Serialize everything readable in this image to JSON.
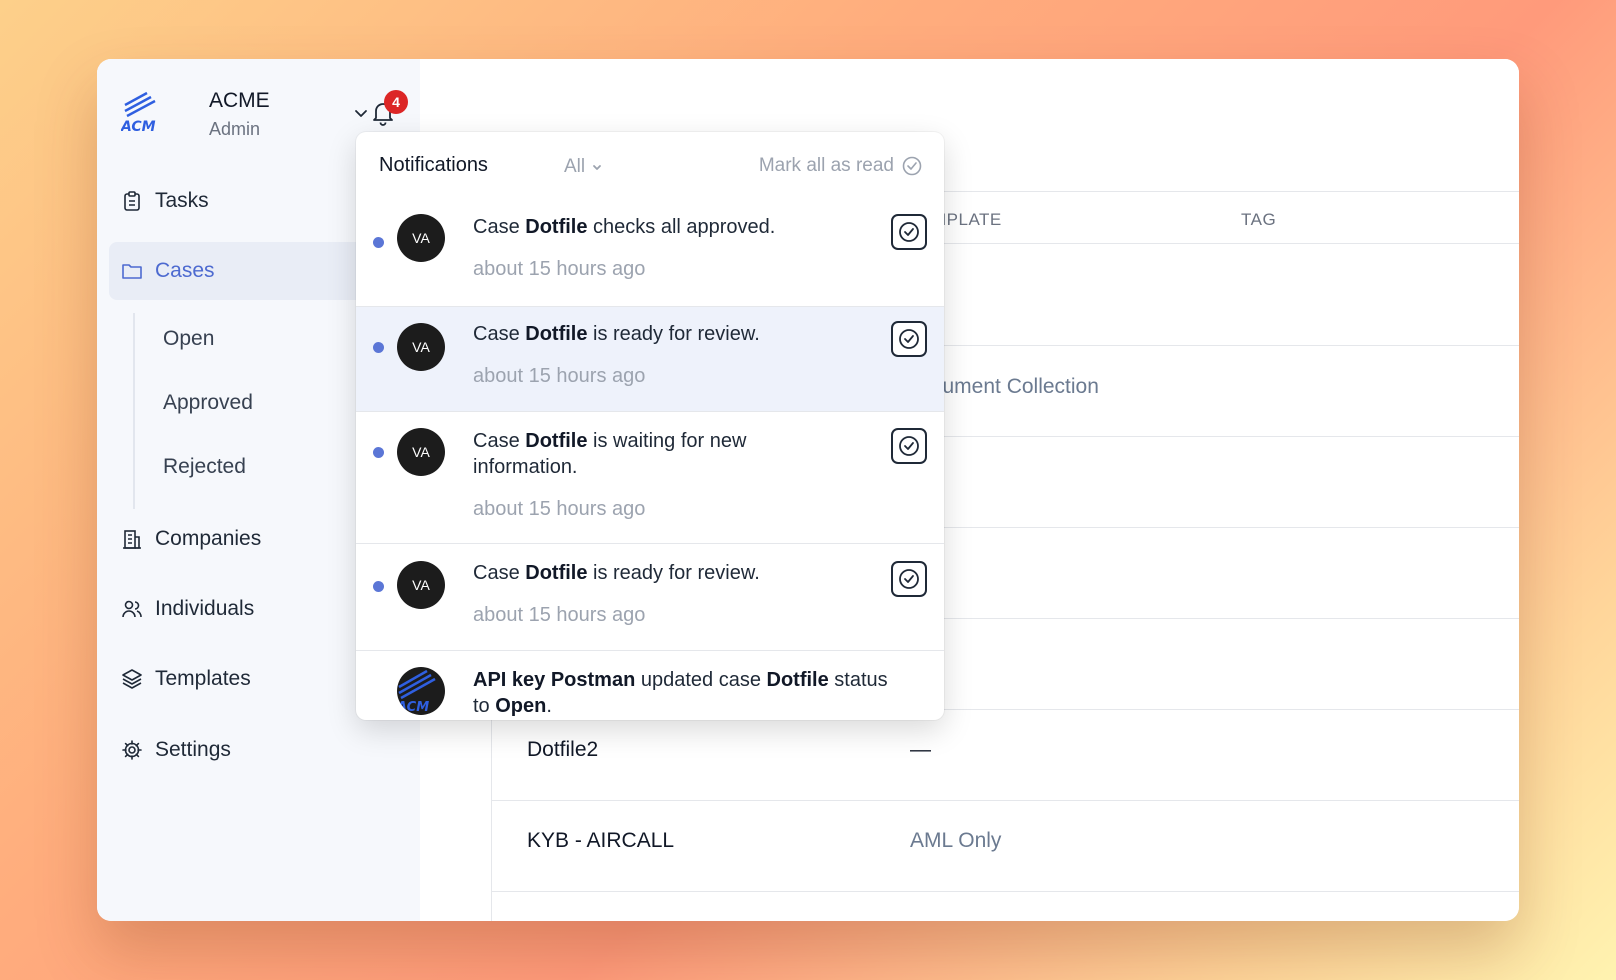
{
  "brand": {
    "name": "ACME",
    "role": "Admin",
    "logo_text": "ACM",
    "notification_count": "4"
  },
  "nav": {
    "tasks": "Tasks",
    "cases": "Cases",
    "sub": {
      "open": "Open",
      "approved": "Approved",
      "rejected": "Rejected"
    },
    "companies": "Companies",
    "individuals": "Individuals",
    "templates": "Templates",
    "settings": "Settings"
  },
  "table": {
    "headers": {
      "template": "MPLATE",
      "tag": "TAG"
    },
    "rows": [
      {
        "name": "",
        "template": ""
      },
      {
        "name": "",
        "template": "cument Collection"
      },
      {
        "name": "",
        "template": ""
      },
      {
        "name": "",
        "template": ""
      },
      {
        "name": "",
        "template": ""
      },
      {
        "name": "Dotfile2",
        "template": "—"
      },
      {
        "name": "KYB - AIRCALL",
        "template": "AML Only"
      }
    ]
  },
  "notifications": {
    "title": "Notifications",
    "filter": "All",
    "mark_all": "Mark all as read",
    "items": [
      {
        "avatar": "VA",
        "pre": "Case ",
        "bold": "Dotfile",
        "post": " checks all approved.",
        "time": "about 15 hours ago"
      },
      {
        "avatar": "VA",
        "pre": "Case ",
        "bold": "Dotfile",
        "post": " is ready for review.",
        "time": "about 15 hours ago"
      },
      {
        "avatar": "VA",
        "pre": "Case ",
        "bold": "Dotfile",
        "post": " is waiting for new information.",
        "time": "about 15 hours ago"
      },
      {
        "avatar": "VA",
        "pre": "Case ",
        "bold": "Dotfile",
        "post": " is ready for review.",
        "time": "about 15 hours ago"
      }
    ],
    "last": {
      "b1": "API key Postman",
      "t1": " updated case ",
      "b2": "Dotfile",
      "t2": " status to ",
      "b3": "Open",
      "t3": "."
    }
  },
  "colors": {
    "accent": "#4d6ad0",
    "unread": "#5b76d6",
    "badge": "#dc2626",
    "avatar": "#1c1c1c"
  }
}
